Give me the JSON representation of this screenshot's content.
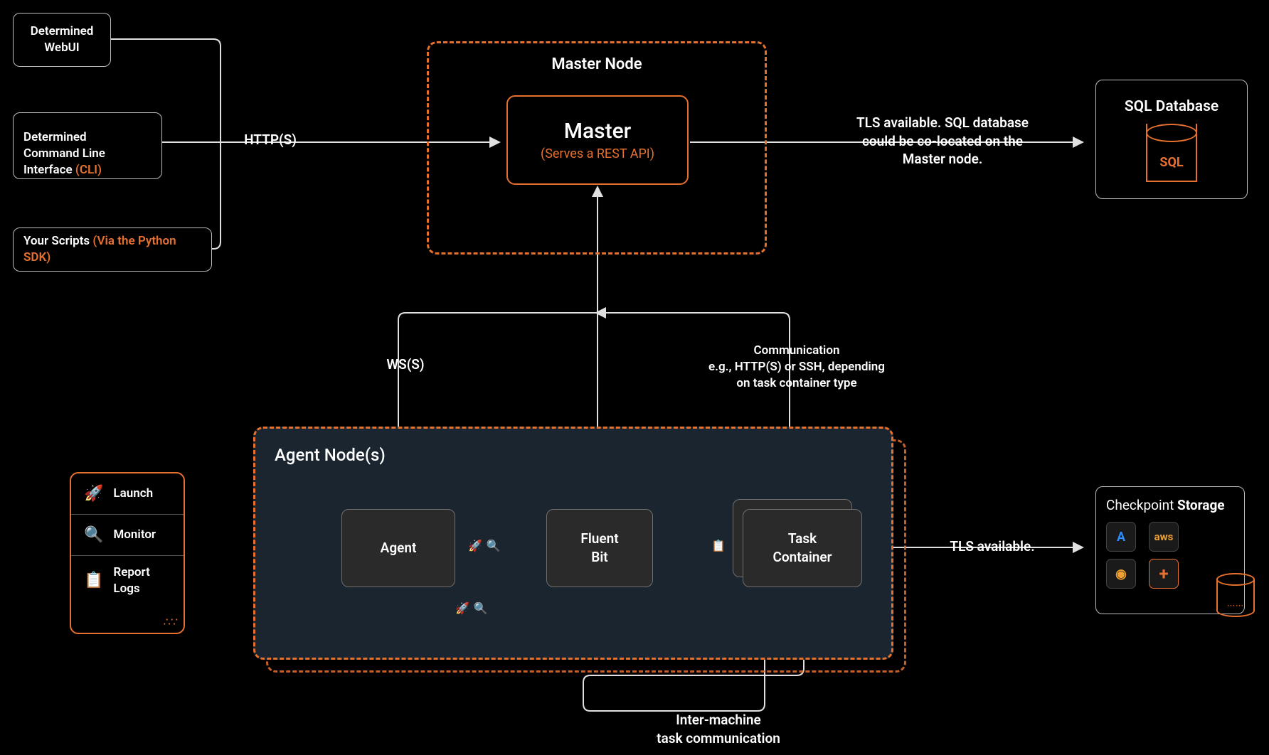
{
  "clients": {
    "webui": "Determined\nWebUI",
    "cli_pre": "Determined\nCommand Line\nInterface ",
    "cli_suf": "(CLI)",
    "scripts_pre": "Your Scripts ",
    "scripts_suf": "(Via the Python SDK)"
  },
  "http_label": "HTTP(S)",
  "master_group": "Master Node",
  "master_title": "Master",
  "master_sub": "(Serves a REST API)",
  "tls_sql": "TLS available. SQL database\ncould be co-located on the\nMaster node.",
  "sql_title": "SQL Database",
  "sql_icon_label": "SQL",
  "wss_label": "WS(S)",
  "comm_label": "Communication\ne.g., HTTP(S) or SSH, depending\non task container type",
  "agent_group": "Agent Node(s)",
  "agent_box": "Agent",
  "fluent_box": "Fluent\nBit",
  "task_box": "Task\nContainer",
  "tls_avail": "TLS available.",
  "ckpt_title_pre": "Checkpoint ",
  "ckpt_title_suf": "Storage",
  "intermachine": "Inter-machine\ntask communication",
  "side_panel": {
    "launch": "Launch",
    "monitor": "Monitor",
    "report": "Report\nLogs"
  },
  "storage_icons": {
    "azure": "A",
    "aws": "aws",
    "gcp": "◉",
    "plus": "+"
  }
}
